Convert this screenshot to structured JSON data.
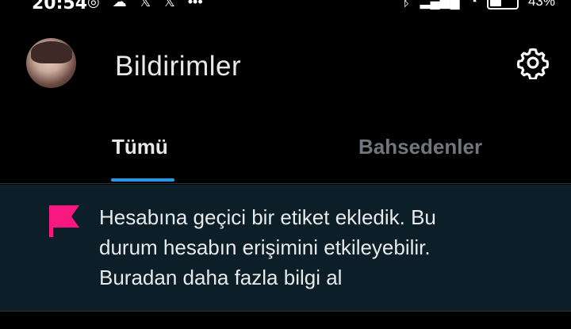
{
  "status_bar": {
    "time": "20:54",
    "battery": "43%"
  },
  "header": {
    "title": "Bildirimler"
  },
  "tabs": [
    {
      "label": "Tümü",
      "active": true
    },
    {
      "label": "Bahsedenler",
      "active": false
    }
  ],
  "notice": {
    "line1": "Hesabına geçici bir etiket ekledik. Bu",
    "line2": "durum hesabın erişimini etkileyebilir.",
    "line3": "Buradan daha fazla bilgi al",
    "icon": "flag-icon"
  },
  "colors": {
    "background": "#000000",
    "accent": "#1d9bf0",
    "flag": "#f91880",
    "notice_bg": "#0c1e28"
  }
}
